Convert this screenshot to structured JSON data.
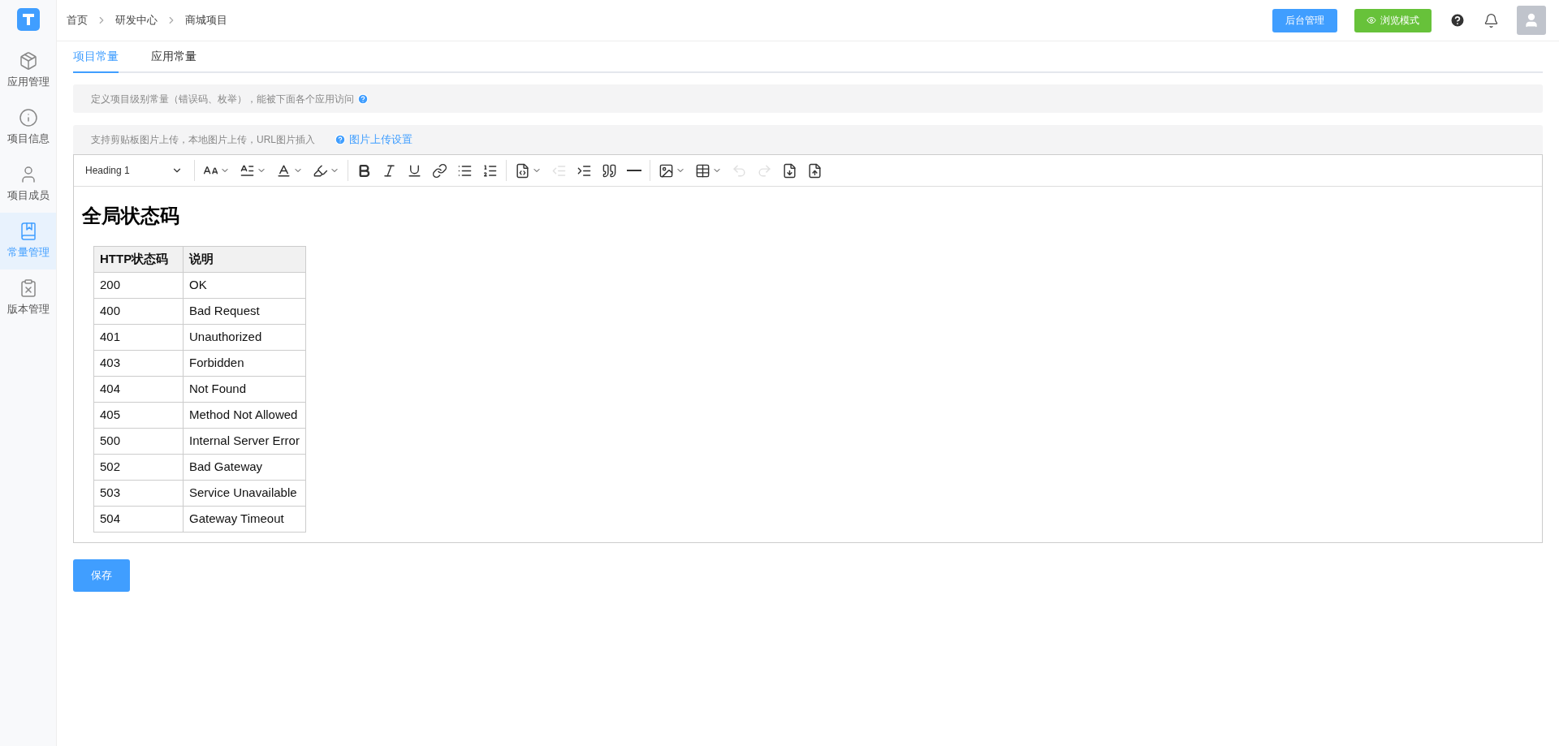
{
  "sidebar": {
    "items": [
      {
        "label": "应用管理",
        "kind": "box",
        "selected": false
      },
      {
        "label": "项目信息",
        "kind": "info",
        "selected": false
      },
      {
        "label": "项目成员",
        "kind": "user",
        "selected": false
      },
      {
        "label": "常量管理",
        "kind": "book",
        "selected": true
      },
      {
        "label": "版本管理",
        "kind": "clipboard",
        "selected": false
      }
    ]
  },
  "breadcrumb": [
    "首页",
    "研发中心",
    "商城项目"
  ],
  "header": {
    "admin_button": "后台管理",
    "preview_button": "浏览模式"
  },
  "tabs": [
    {
      "label": "项目常量",
      "selected": true
    },
    {
      "label": "应用常量",
      "selected": false
    }
  ],
  "description": "定义项目级别常量（错误码、枚举），能被下面各个应用访问",
  "upload_hint": "支持剪贴板图片上传，本地图片上传，URL图片插入",
  "upload_settings_link": "图片上传设置",
  "toolbar": {
    "heading": "Heading 1",
    "tools": [
      {
        "kind": "separator"
      },
      {
        "kind": "font-size",
        "dropdown": true,
        "disabled": false
      },
      {
        "kind": "line-height",
        "dropdown": true,
        "disabled": false
      },
      {
        "kind": "font-color",
        "dropdown": true,
        "disabled": false
      },
      {
        "kind": "bg-color",
        "dropdown": true,
        "disabled": false
      },
      {
        "kind": "separator"
      },
      {
        "kind": "bold",
        "dropdown": false,
        "disabled": false
      },
      {
        "kind": "italic",
        "dropdown": false,
        "disabled": false
      },
      {
        "kind": "underline",
        "dropdown": false,
        "disabled": false
      },
      {
        "kind": "link",
        "dropdown": false,
        "disabled": false
      },
      {
        "kind": "bullet-list",
        "dropdown": false,
        "disabled": false
      },
      {
        "kind": "numbered-list",
        "dropdown": false,
        "disabled": false
      },
      {
        "kind": "separator"
      },
      {
        "kind": "code",
        "dropdown": true,
        "disabled": false
      },
      {
        "kind": "outdent",
        "dropdown": false,
        "disabled": true
      },
      {
        "kind": "indent",
        "dropdown": false,
        "disabled": false
      },
      {
        "kind": "quote",
        "dropdown": false,
        "disabled": false
      },
      {
        "kind": "divider",
        "dropdown": false,
        "disabled": false
      },
      {
        "kind": "separator"
      },
      {
        "kind": "image",
        "dropdown": true,
        "disabled": false
      },
      {
        "kind": "table",
        "dropdown": true,
        "disabled": false
      },
      {
        "kind": "undo",
        "dropdown": false,
        "disabled": true
      },
      {
        "kind": "redo",
        "dropdown": false,
        "disabled": true
      },
      {
        "kind": "word-import",
        "dropdown": false,
        "disabled": false
      },
      {
        "kind": "word-export",
        "dropdown": false,
        "disabled": false
      }
    ]
  },
  "document": {
    "title": "全局状态码",
    "table": {
      "columns": [
        "HTTP状态码",
        "说明"
      ],
      "rows": [
        [
          "200",
          "OK"
        ],
        [
          "400",
          "Bad Request"
        ],
        [
          "401",
          "Unauthorized"
        ],
        [
          "403",
          "Forbidden"
        ],
        [
          "404",
          "Not Found"
        ],
        [
          "405",
          "Method Not Allowed"
        ],
        [
          "500",
          "Internal Server Error"
        ],
        [
          "502",
          "Bad Gateway"
        ],
        [
          "503",
          "Service Unavailable"
        ],
        [
          "504",
          "Gateway Timeout"
        ]
      ]
    }
  },
  "save_button": "保存"
}
